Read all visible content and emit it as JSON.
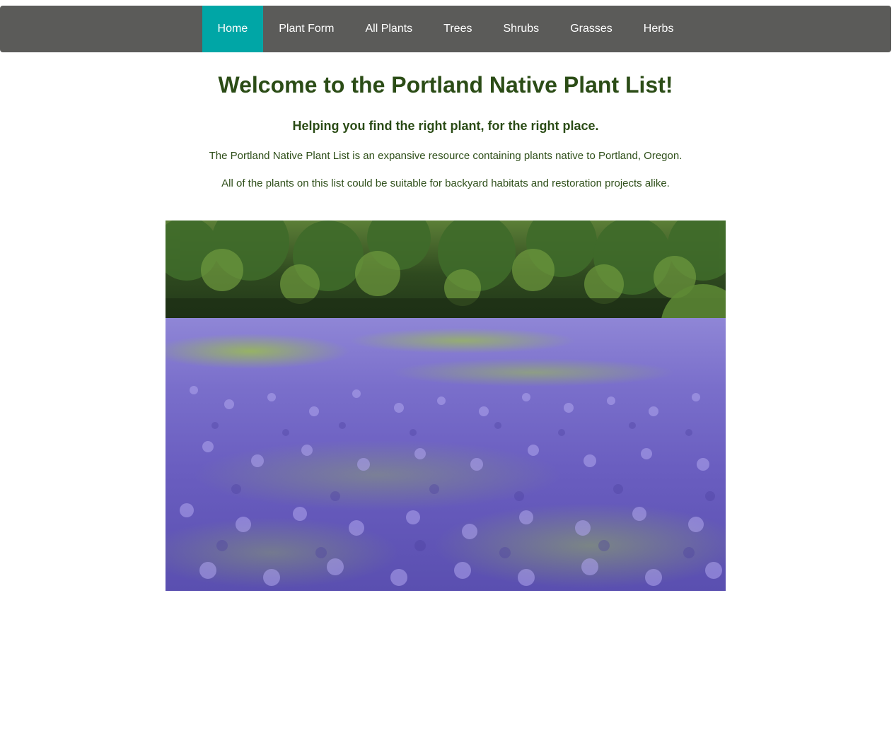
{
  "nav": {
    "items": [
      {
        "label": "Home",
        "active": true
      },
      {
        "label": "Plant Form",
        "active": false
      },
      {
        "label": "All Plants",
        "active": false
      },
      {
        "label": "Trees",
        "active": false
      },
      {
        "label": "Shrubs",
        "active": false
      },
      {
        "label": "Grasses",
        "active": false
      },
      {
        "label": "Herbs",
        "active": false
      }
    ]
  },
  "main": {
    "title": "Welcome to the Portland Native Plant List!",
    "subtitle": "Helping you find the right plant, for the right place.",
    "paragraph_1": "The Portland Native Plant List is an expansive resource containing plants native to Portland, Oregon.",
    "paragraph_2": "All of the plants on this list could be suitable for backyard habitats and restoration projects alike."
  },
  "colors": {
    "navbar_bg": "#5b5b59",
    "nav_active": "#00a6a6",
    "heading_green": "#2b4c16"
  }
}
